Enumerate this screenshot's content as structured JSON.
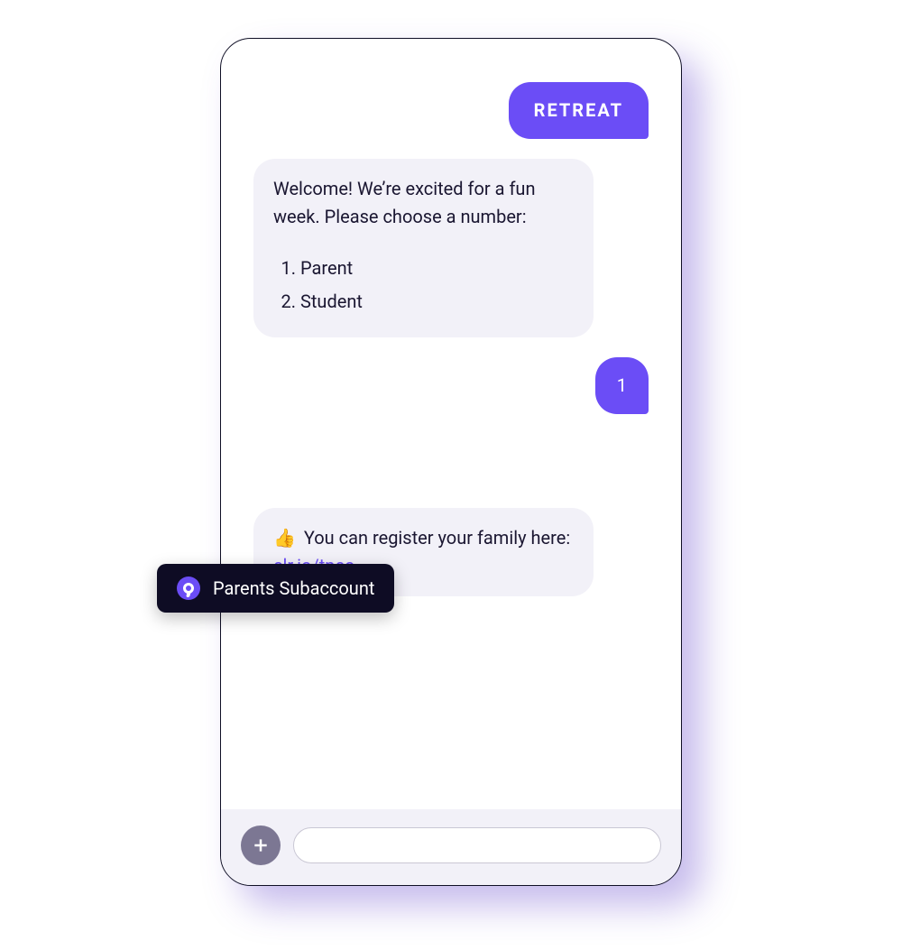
{
  "chat": {
    "messages": {
      "m0": {
        "text": "RETREAT"
      },
      "m1": {
        "intro": "Welcome! We’re excited for a fun week. Please choose a number:",
        "options": [
          "Parent",
          "Student"
        ]
      },
      "m2": {
        "text": "1"
      },
      "m3": {
        "emoji": "👍",
        "text_before_link": " You can register your family here: ",
        "link_text": "clr.io/tpco"
      }
    }
  },
  "tooltip": {
    "label": "Parents Subaccount"
  },
  "input": {
    "placeholder": ""
  },
  "colors": {
    "accent": "#6b4df6",
    "bubble_received": "#f2f1f8",
    "tooltip_bg": "#0e0c24"
  }
}
